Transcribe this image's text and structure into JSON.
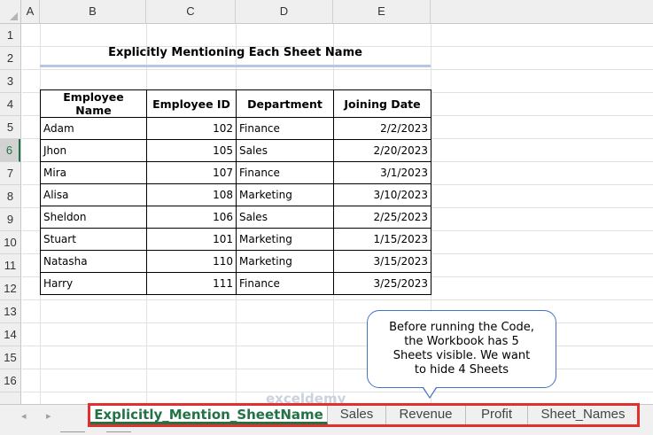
{
  "columns": [
    "A",
    "B",
    "C",
    "D",
    "E"
  ],
  "rows": [
    "1",
    "2",
    "3",
    "4",
    "5",
    "6",
    "7",
    "8",
    "9",
    "10",
    "11",
    "12",
    "13",
    "14",
    "15",
    "16"
  ],
  "selected_row": "6",
  "title": "Explicitly Mentioning Each Sheet Name",
  "table": {
    "headers": [
      "Employee Name",
      "Employee ID",
      "Department",
      "Joining Date"
    ],
    "rows": [
      [
        "Adam",
        "102",
        "Finance",
        "2/2/2023"
      ],
      [
        "Jhon",
        "105",
        "Sales",
        "2/20/2023"
      ],
      [
        "Mira",
        "107",
        "Finance",
        "3/1/2023"
      ],
      [
        "Alisa",
        "108",
        "Marketing",
        "3/10/2023"
      ],
      [
        "Sheldon",
        "106",
        "Sales",
        "2/25/2023"
      ],
      [
        "Stuart",
        "101",
        "Marketing",
        "1/15/2023"
      ],
      [
        "Natasha",
        "110",
        "Marketing",
        "3/15/2023"
      ],
      [
        "Harry",
        "111",
        "Finance",
        "3/25/2023"
      ]
    ]
  },
  "callout": {
    "lines": [
      "Before running the Code,",
      "the Workbook has 5",
      "Sheets visible. We want",
      "to hide 4 Sheets"
    ]
  },
  "sheet_tabs": [
    "Explicitly_Mention_SheetName",
    "Sales",
    "Revenue",
    "Profit",
    "Sheet_Names"
  ],
  "active_tab": "Explicitly_Mention_SheetName",
  "watermark": "exceldemy",
  "colors": {
    "excel_green": "#217346",
    "highlight_red": "#e03131",
    "callout_border": "#4472c4",
    "title_underline": "#b4c7e7"
  },
  "icons": {
    "scroll_left": "◂",
    "scroll_right": "▸"
  }
}
